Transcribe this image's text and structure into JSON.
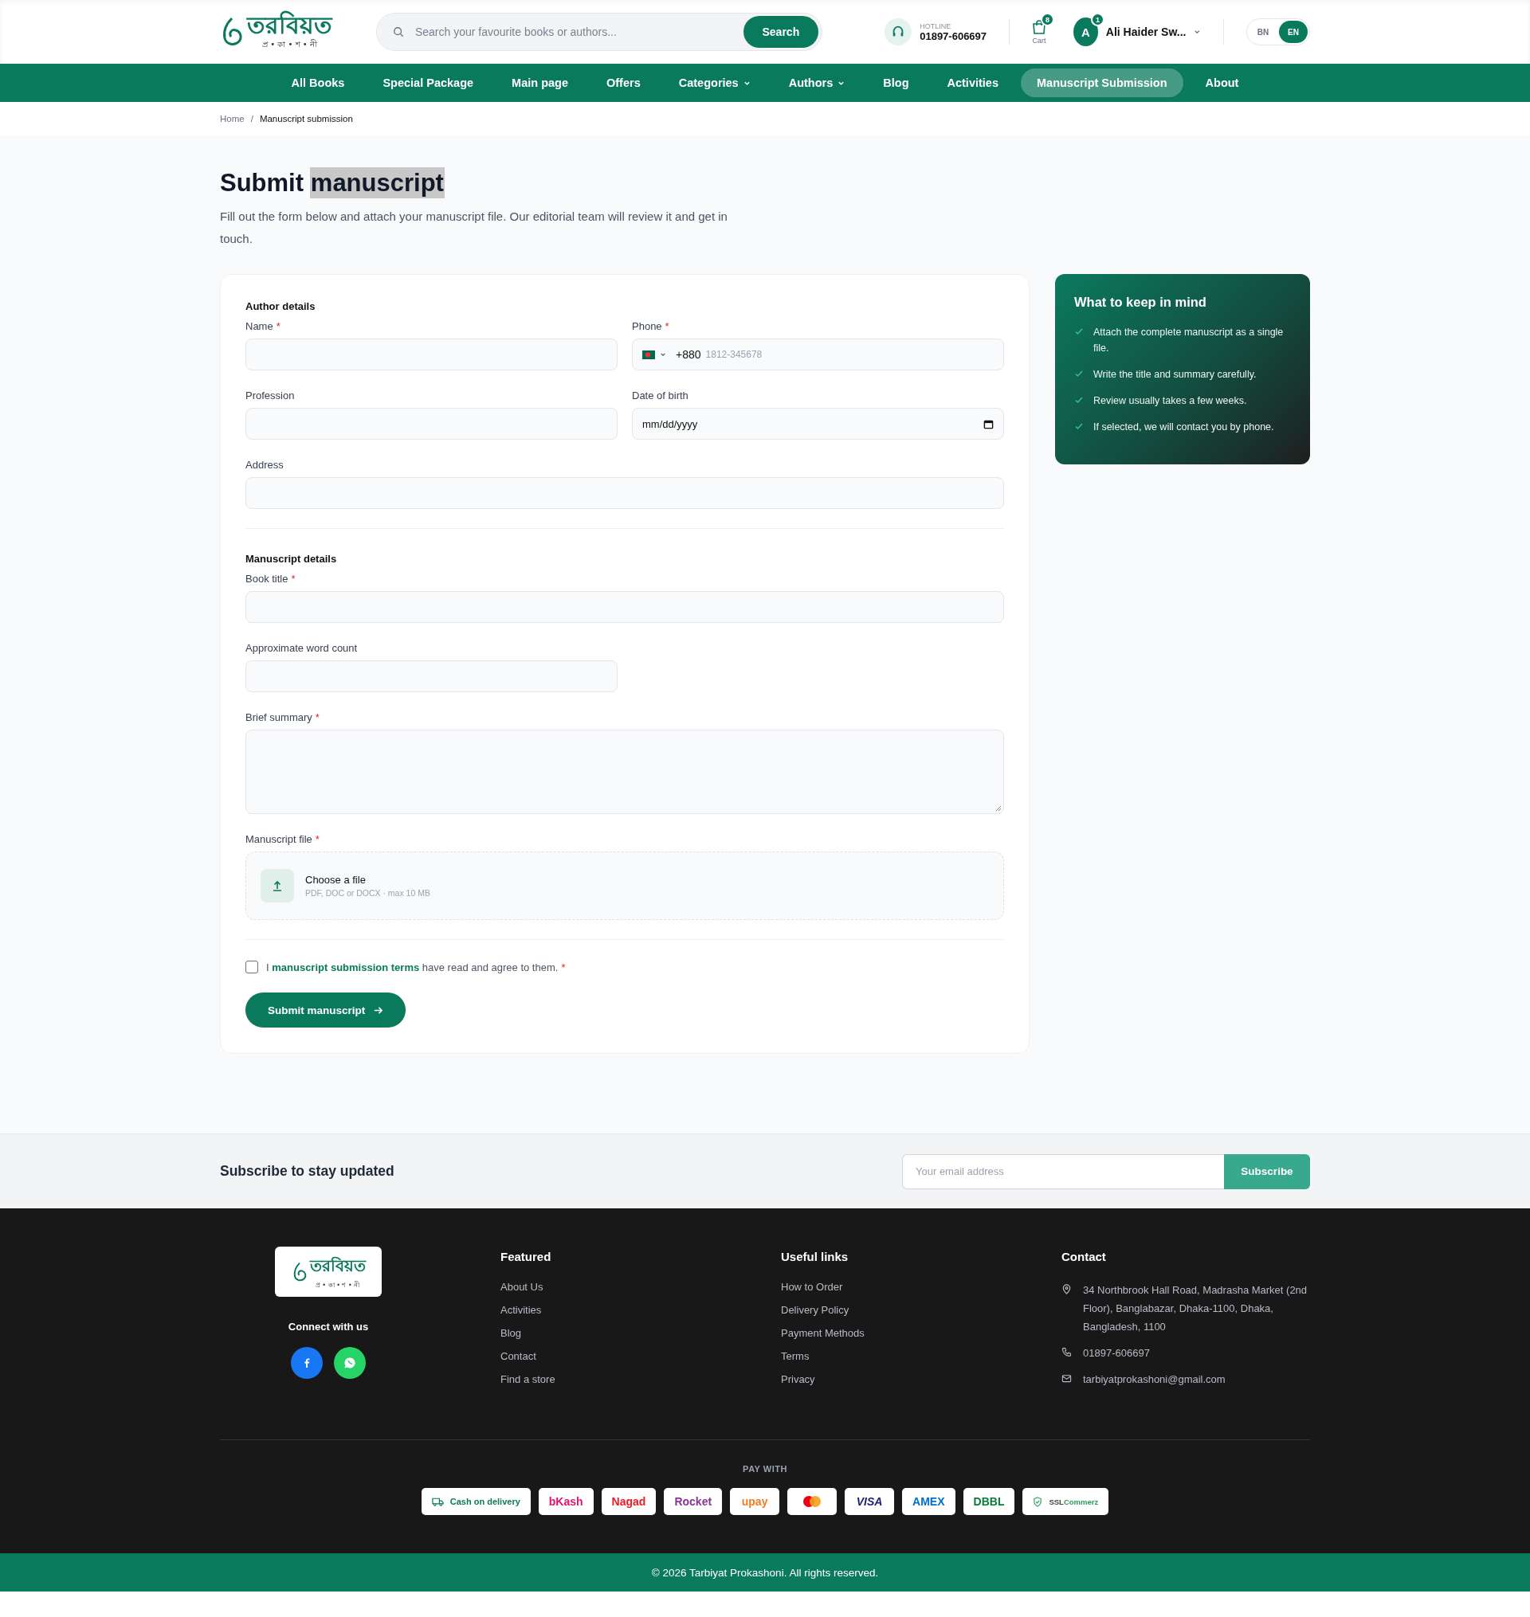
{
  "header": {
    "logo": {
      "name": "তরবিয়ত",
      "tagline": "প্র • কা • শ • নী"
    },
    "search": {
      "placeholder": "Search your favourite books or authors...",
      "button": "Search"
    },
    "hotline": {
      "label": "HOTLINE",
      "number": "01897-606697"
    },
    "cart": {
      "label": "Cart",
      "count": "8"
    },
    "user": {
      "initial": "A",
      "badge": "1",
      "name": "Ali Haider Sw..."
    },
    "languages": [
      {
        "label": "BN",
        "selected": false
      },
      {
        "label": "EN",
        "selected": true
      }
    ]
  },
  "nav": [
    {
      "label": "All Books",
      "selected": false,
      "dropdown": false
    },
    {
      "label": "Special Package",
      "selected": false,
      "dropdown": false
    },
    {
      "label": "Main page",
      "selected": false,
      "dropdown": false
    },
    {
      "label": "Offers",
      "selected": false,
      "dropdown": false
    },
    {
      "label": "Categories",
      "selected": false,
      "dropdown": true
    },
    {
      "label": "Authors",
      "selected": false,
      "dropdown": true
    },
    {
      "label": "Blog",
      "selected": false,
      "dropdown": false
    },
    {
      "label": "Activities",
      "selected": false,
      "dropdown": false
    },
    {
      "label": "Manuscript Submission",
      "selected": true,
      "dropdown": false
    },
    {
      "label": "About",
      "selected": false,
      "dropdown": false
    }
  ],
  "breadcrumb": {
    "items": [
      "Home",
      "Manuscript submission"
    ],
    "separator": "/"
  },
  "page": {
    "title": [
      {
        "text": "Submit",
        "highlighted": false
      },
      {
        "text": "manuscript",
        "highlighted": true
      }
    ],
    "description": "Fill out the form below and attach your manuscript file. Our editorial team will review it and get in touch."
  },
  "form": {
    "required_mark": "*",
    "sections": [
      {
        "heading": "Author details",
        "fields": [
          {
            "kind": "text",
            "label": "Name",
            "required": true
          },
          {
            "kind": "phone",
            "label": "Phone",
            "required": true,
            "code": "+880",
            "placeholder": "1812-345678"
          },
          {
            "kind": "text",
            "label": "Profession",
            "required": false
          },
          {
            "kind": "date",
            "label": "Date of birth",
            "required": false,
            "placeholder": "mm/dd/yyyy"
          },
          {
            "kind": "wide",
            "label": "Address",
            "required": false
          }
        ]
      },
      {
        "heading": "Manuscript details",
        "fields": [
          {
            "kind": "wide",
            "label": "Book title",
            "required": true
          },
          {
            "kind": "text",
            "label": "Approximate word count",
            "required": false
          },
          {
            "kind": "textarea",
            "label": "Brief summary",
            "required": true
          },
          {
            "kind": "file",
            "label": "Manuscript file",
            "required": true,
            "title": "Choose a file",
            "hint": "PDF, DOC or DOCX · max 10 MB"
          }
        ]
      }
    ],
    "agreement": {
      "checked": false,
      "prefix": "I",
      "link": "manuscript submission terms",
      "suffix": "have read and agree to them.",
      "required": true
    },
    "submit": "Submit manuscript"
  },
  "tips": {
    "title": "What to keep in mind",
    "items": [
      "Attach the complete manuscript as a single file.",
      "Write the title and summary carefully.",
      "Review usually takes a few weeks.",
      "If selected, we will contact you by phone."
    ]
  },
  "subscribe": {
    "title": "Subscribe to stay updated",
    "placeholder": "Your email address",
    "button": "Subscribe"
  },
  "footer": {
    "logo": {
      "name": "তরবিয়ত",
      "tagline": "প্র • কা • শ • নী"
    },
    "connect": "Connect with us",
    "columns": [
      {
        "title": "Featured",
        "links": [
          "About Us",
          "Activities",
          "Blog",
          "Contact",
          "Find a store"
        ]
      },
      {
        "title": "Useful links",
        "links": [
          "How to Order",
          "Delivery Policy",
          "Payment Methods",
          "Terms",
          "Privacy"
        ]
      }
    ],
    "contact": {
      "title": "Contact",
      "items": [
        {
          "kind": "address",
          "text": "34 Northbrook Hall Road, Madrasha Market (2nd Floor), Banglabazar, Dhaka-1100, Dhaka, Bangladesh, 1100"
        },
        {
          "kind": "phone",
          "text": "01897-606697"
        },
        {
          "kind": "email",
          "text": "tarbiyatprokashoni@gmail.com"
        }
      ]
    },
    "pay_with": "PAY WITH",
    "payments": [
      {
        "kind": "cod",
        "label": "Cash on delivery",
        "color": "#0a7a5c"
      },
      {
        "kind": "text",
        "label": "bKash",
        "color": "#e2136e"
      },
      {
        "kind": "text",
        "label": "Nagad",
        "color": "#ec1c24"
      },
      {
        "kind": "text",
        "label": "Rocket",
        "color": "#8c3494"
      },
      {
        "kind": "text",
        "label": "upay",
        "color": "#f47b20"
      },
      {
        "kind": "mastercard"
      },
      {
        "kind": "italic",
        "label": "VISA",
        "color": "#1a1f71"
      },
      {
        "kind": "text",
        "label": "AMEX",
        "color": "#016fd0"
      },
      {
        "kind": "text",
        "label": "DBBL",
        "color": "#0a7a3b"
      },
      {
        "kind": "ssl",
        "label": "SSL",
        "label2": "Commerz",
        "color": "#2e9d5b"
      }
    ],
    "copyright": "© 2026 Tarbiyat Prokashoni. All rights reserved."
  }
}
